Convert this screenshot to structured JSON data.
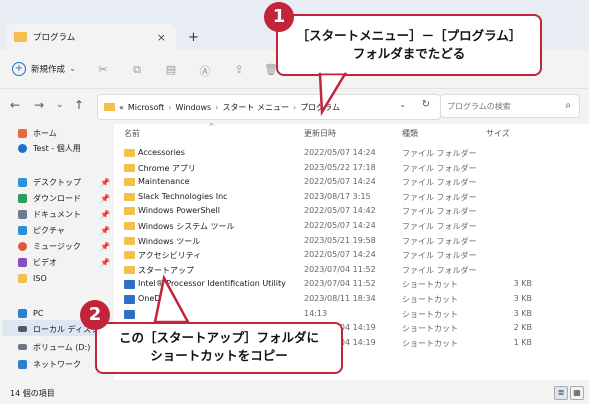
{
  "tab": {
    "title": "プログラム",
    "add": "+",
    "close": "×"
  },
  "toolbar": {
    "new_label": "新規作成",
    "new_chevron": "⌄"
  },
  "address": {
    "prefix": "«",
    "crumbs": [
      "Microsoft",
      "Windows",
      "スタート メニュー",
      "プログラム"
    ],
    "search_placeholder": "プログラムの検索"
  },
  "sidebar": {
    "items": [
      {
        "label": "ホーム",
        "icon": "home-icon",
        "color": "#e36a3a"
      },
      {
        "label": "Test - 個人用",
        "icon": "cloud-icon",
        "color": "#1f6fd1"
      },
      {
        "label": "デスクトップ",
        "icon": "desktop-icon",
        "color": "#2f8fd8",
        "pin": true
      },
      {
        "label": "ダウンロード",
        "icon": "download-icon",
        "color": "#2a9d5a",
        "pin": true
      },
      {
        "label": "ドキュメント",
        "icon": "document-icon",
        "color": "#6b7c93",
        "pin": true
      },
      {
        "label": "ピクチャ",
        "icon": "pictures-icon",
        "color": "#2d8fd5",
        "pin": true
      },
      {
        "label": "ミュージック",
        "icon": "music-icon",
        "color": "#e0573d",
        "pin": true
      },
      {
        "label": "ビデオ",
        "icon": "video-icon",
        "color": "#8a4bc4",
        "pin": true
      },
      {
        "label": "ISO",
        "icon": "folder-icon",
        "color": "#f2c04b"
      },
      {
        "label": "PC",
        "icon": "pc-icon",
        "color": "#2f7fd0"
      },
      {
        "label": "ローカル ディスク",
        "icon": "drive-icon",
        "color": "#4a5a70"
      },
      {
        "label": "ボリューム (D:)",
        "icon": "drive-icon",
        "color": "#6a7686"
      },
      {
        "label": "ネットワーク",
        "icon": "network-icon",
        "color": "#2f7fd0"
      }
    ]
  },
  "columns": {
    "name": "名前",
    "date": "更新日時",
    "type": "種類",
    "size": "サイズ"
  },
  "files": [
    {
      "name": "Accessories",
      "date": "2022/05/07 14:24",
      "type": "ファイル フォルダー",
      "size": "",
      "kind": "folder"
    },
    {
      "name": "Chrome アプリ",
      "date": "2023/05/22 17:18",
      "type": "ファイル フォルダー",
      "size": "",
      "kind": "folder"
    },
    {
      "name": "Maintenance",
      "date": "2022/05/07 14:24",
      "type": "ファイル フォルダー",
      "size": "",
      "kind": "folder"
    },
    {
      "name": "Slack Technologies Inc",
      "date": "2023/08/17 3:15",
      "type": "ファイル フォルダー",
      "size": "",
      "kind": "folder"
    },
    {
      "name": "Windows PowerShell",
      "date": "2022/05/07 14:42",
      "type": "ファイル フォルダー",
      "size": "",
      "kind": "folder"
    },
    {
      "name": "Windows システム ツール",
      "date": "2022/05/07 14:24",
      "type": "ファイル フォルダー",
      "size": "",
      "kind": "folder"
    },
    {
      "name": "Windows ツール",
      "date": "2023/05/21 19:58",
      "type": "ファイル フォルダー",
      "size": "",
      "kind": "folder"
    },
    {
      "name": "アクセシビリティ",
      "date": "2022/05/07 14:24",
      "type": "ファイル フォルダー",
      "size": "",
      "kind": "folder"
    },
    {
      "name": "スタートアップ",
      "date": "2023/07/04 11:52",
      "type": "ファイル フォルダー",
      "size": "",
      "kind": "folder"
    },
    {
      "name": "Intel® Processor Identification Utility",
      "date": "2023/07/04 11:52",
      "type": "ショートカット",
      "size": "3 KB",
      "kind": "shortcut"
    },
    {
      "name": "OneDrive",
      "date": "2023/08/11 18:34",
      "type": "ショートカット",
      "size": "3 KB",
      "kind": "shortcut"
    },
    {
      "name": "",
      "date": "14:13",
      "type": "ショートカット",
      "size": "3 KB",
      "kind": "shortcut"
    },
    {
      "name": "",
      "date": "2023/07/04 14:19",
      "type": "ショートカット",
      "size": "2 KB",
      "kind": "shortcut"
    },
    {
      "name": "",
      "date": "2023/07/04 14:19",
      "type": "ショートカット",
      "size": "1 KB",
      "kind": "shortcut"
    }
  ],
  "status": {
    "count": "14 個の項目"
  },
  "callouts": {
    "one": {
      "badge": "1",
      "line1": "［スタートメニュー］－［プログラム］",
      "line2": "フォルダまでたどる"
    },
    "two": {
      "badge": "2",
      "line1": "この［スタートアップ］フォルダに",
      "line2": "ショートカットをコピー"
    }
  },
  "colors": {
    "accent": "#c2243a",
    "folder": "#f2c04b"
  }
}
